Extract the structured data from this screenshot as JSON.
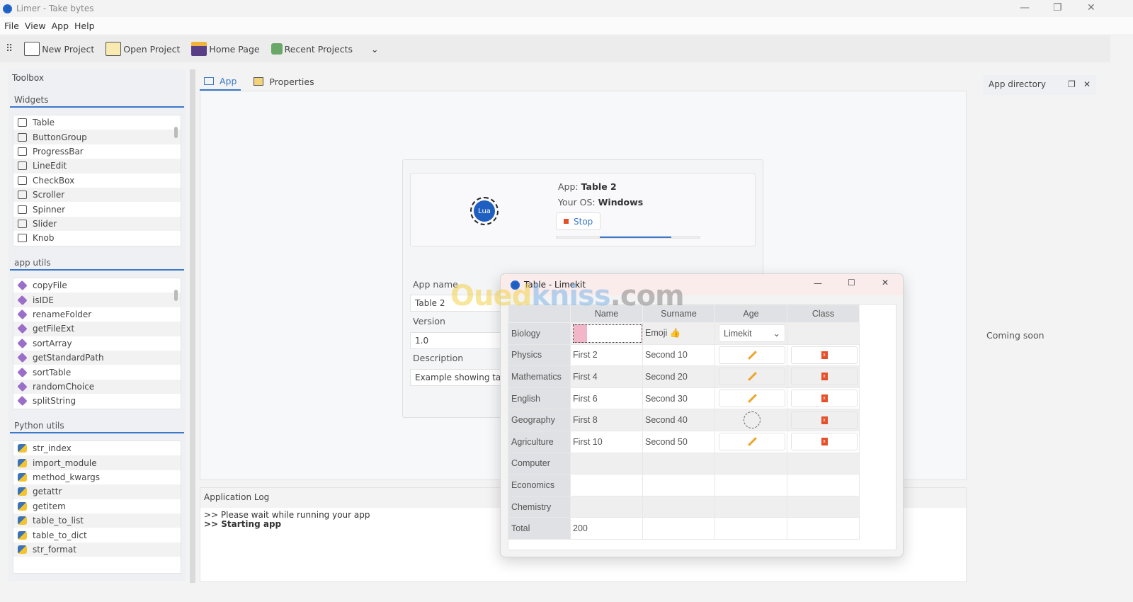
{
  "window": {
    "title": "Limer - Take bytes"
  },
  "menu": [
    "File",
    "View",
    "App",
    "Help"
  ],
  "toolbar": {
    "items": [
      {
        "label": "New Project",
        "icon": "new-window-icon"
      },
      {
        "label": "Open Project",
        "icon": "folder-icon"
      },
      {
        "label": "Home Page",
        "icon": "floppy-icon"
      },
      {
        "label": "Recent Projects",
        "icon": "recent-icon"
      }
    ]
  },
  "toolbox": {
    "title": "Toolbox",
    "widgets": {
      "title": "Widgets",
      "items": [
        "Table",
        "ButtonGroup",
        "ProgressBar",
        "LineEdit",
        "CheckBox",
        "Scroller",
        "Spinner",
        "Slider",
        "Knob"
      ]
    },
    "app_utils": {
      "title": "app utils",
      "items": [
        "copyFile",
        "isIDE",
        "renameFolder",
        "getFileExt",
        "sortArray",
        "getStandardPath",
        "sortTable",
        "randomChoice",
        "splitString"
      ]
    },
    "python_utils": {
      "title": "Python utils",
      "items": [
        "str_index",
        "import_module",
        "method_kwargs",
        "getattr",
        "getitem",
        "table_to_list",
        "table_to_dict",
        "str_format"
      ]
    }
  },
  "tabs": [
    {
      "label": "App",
      "active": true
    },
    {
      "label": "Properties",
      "active": false
    }
  ],
  "app_card": {
    "logo_text": "Lua",
    "app_label": "App:",
    "app_value": "Table 2",
    "os_label": "Your OS:",
    "os_value": "Windows",
    "stop_label": "Stop",
    "progress_percent": 50,
    "app_name_label": "App name",
    "app_name_value": "Table 2",
    "version_label": "Version",
    "version_value": "1.0",
    "description_label": "Description",
    "description_value": "Example showing tab"
  },
  "log": {
    "title": "Application Log",
    "lines": [
      ">> Please wait while running your app",
      ">> Starting app"
    ]
  },
  "right_panel": {
    "title": "App directory",
    "body": "Coming soon"
  },
  "dialog": {
    "title": "Table - Limekit",
    "columns": [
      "Name",
      "Surname",
      "Age",
      "Class"
    ],
    "rows": [
      {
        "header": "Biology",
        "name": "",
        "surname": "Emoji 👍",
        "age": {
          "type": "combo",
          "value": "Limekit"
        },
        "class": {
          "type": "empty"
        }
      },
      {
        "header": "Physics",
        "name": "First 2",
        "surname": "Second 10",
        "age": {
          "type": "edit"
        },
        "class": {
          "type": "delete"
        }
      },
      {
        "header": "Mathematics",
        "name": "First 4",
        "surname": "Second 20",
        "age": {
          "type": "edit"
        },
        "class": {
          "type": "delete"
        }
      },
      {
        "header": "English",
        "name": "First 6",
        "surname": "Second 30",
        "age": {
          "type": "edit"
        },
        "class": {
          "type": "delete"
        }
      },
      {
        "header": "Geography",
        "name": "First 8",
        "surname": "Second 40",
        "age": {
          "type": "knob"
        },
        "class": {
          "type": "delete"
        }
      },
      {
        "header": "Agriculture",
        "name": "First 10",
        "surname": "Second 50",
        "age": {
          "type": "edit"
        },
        "class": {
          "type": "delete"
        }
      },
      {
        "header": "Computer",
        "name": "",
        "surname": "",
        "age": {
          "type": "empty"
        },
        "class": {
          "type": "empty"
        }
      },
      {
        "header": "Economics",
        "name": "",
        "surname": "",
        "age": {
          "type": "empty"
        },
        "class": {
          "type": "empty"
        }
      },
      {
        "header": "Chemistry",
        "name": "",
        "surname": "",
        "age": {
          "type": "empty"
        },
        "class": {
          "type": "empty"
        }
      },
      {
        "header": "Total",
        "name": "200",
        "surname": "",
        "age": {
          "type": "empty"
        },
        "class": {
          "type": "empty"
        }
      }
    ]
  },
  "watermark": "Ouedkniss.com",
  "colors": {
    "accent": "#3b78c9",
    "stop": "#e5502a",
    "pencil": "#f0a52a"
  }
}
